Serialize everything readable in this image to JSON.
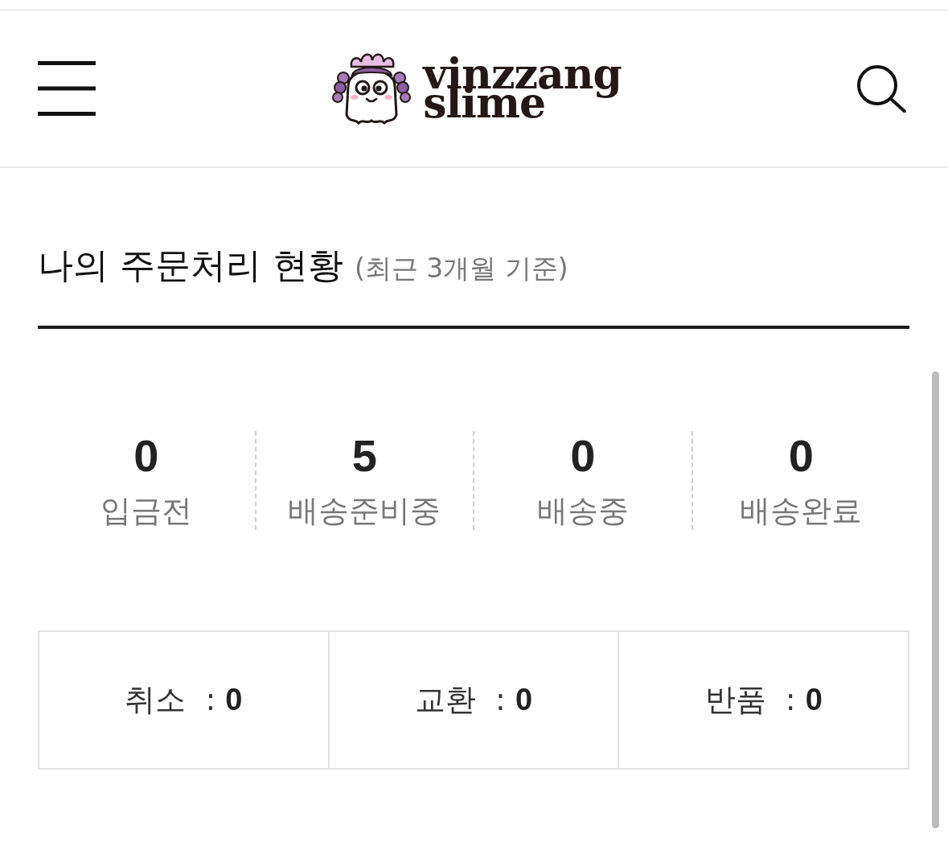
{
  "header": {
    "logo": {
      "lines": [
        "vinzzang",
        "slime"
      ]
    }
  },
  "section": {
    "title": "나의 주문처리 현황",
    "subtitle": "(최근 3개월 기준)"
  },
  "order_status": [
    {
      "count": "0",
      "label": "입금전"
    },
    {
      "count": "5",
      "label": "배송준비중"
    },
    {
      "count": "0",
      "label": "배송중"
    },
    {
      "count": "0",
      "label": "배송완료"
    }
  ],
  "claims": [
    {
      "text": "취소  : **0**"
    },
    {
      "text": "교환  : **0**"
    },
    {
      "text": "반품  : **0**"
    }
  ]
}
